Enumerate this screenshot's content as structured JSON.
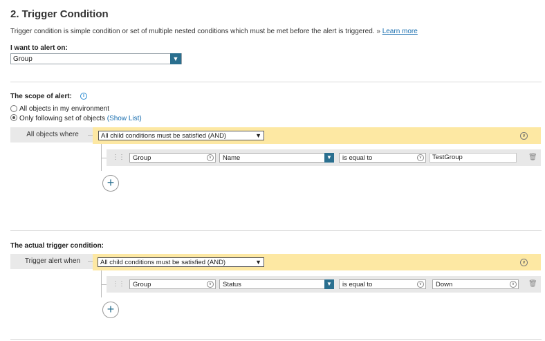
{
  "section": {
    "title": "2. Trigger Condition",
    "description": "Trigger condition is simple condition or set of multiple nested conditions which must be met before the alert is triggered. »",
    "learn_more": "Learn more"
  },
  "alert_on": {
    "label": "I want to alert on:",
    "value": "Group"
  },
  "scope": {
    "label": "The scope of alert:",
    "info_icon": "info-icon",
    "options": [
      {
        "label": "All objects in my environment",
        "selected": false
      },
      {
        "label": "Only following set of objects",
        "selected": true
      }
    ],
    "show_list": "(Show List)",
    "where_label": "All objects where",
    "and_select": "All child conditions must be satisfied (AND)",
    "condition": {
      "object": "Group",
      "field": "Name",
      "operator": "is equal to",
      "value": "TestGroup"
    }
  },
  "trigger": {
    "label": "The actual trigger condition:",
    "when_label": "Trigger alert when",
    "and_select": "All child conditions must be satisfied (AND)",
    "condition": {
      "object": "Group",
      "field": "Status",
      "operator": "is equal to",
      "value": "Down"
    }
  },
  "colors": {
    "accent": "#2a6f8f",
    "group_bg": "#fde8a3",
    "link": "#1a6fb0"
  }
}
